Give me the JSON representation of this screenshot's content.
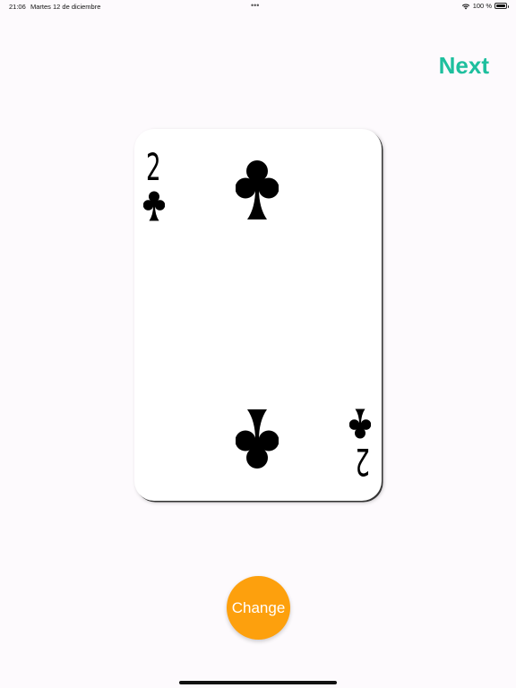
{
  "status_bar": {
    "time": "21:06",
    "date": "Martes 12 de diciembre",
    "dots": "•••",
    "battery": "100 %"
  },
  "toolbar": {
    "next_label": "Next"
  },
  "card": {
    "rank": "2",
    "suit": "clubs-icon",
    "color": "#000000"
  },
  "actions": {
    "change_label": "Change"
  },
  "colors": {
    "accent_next": "#1ebf9e",
    "change_button": "#fda00d",
    "background": "#fdfafd"
  }
}
